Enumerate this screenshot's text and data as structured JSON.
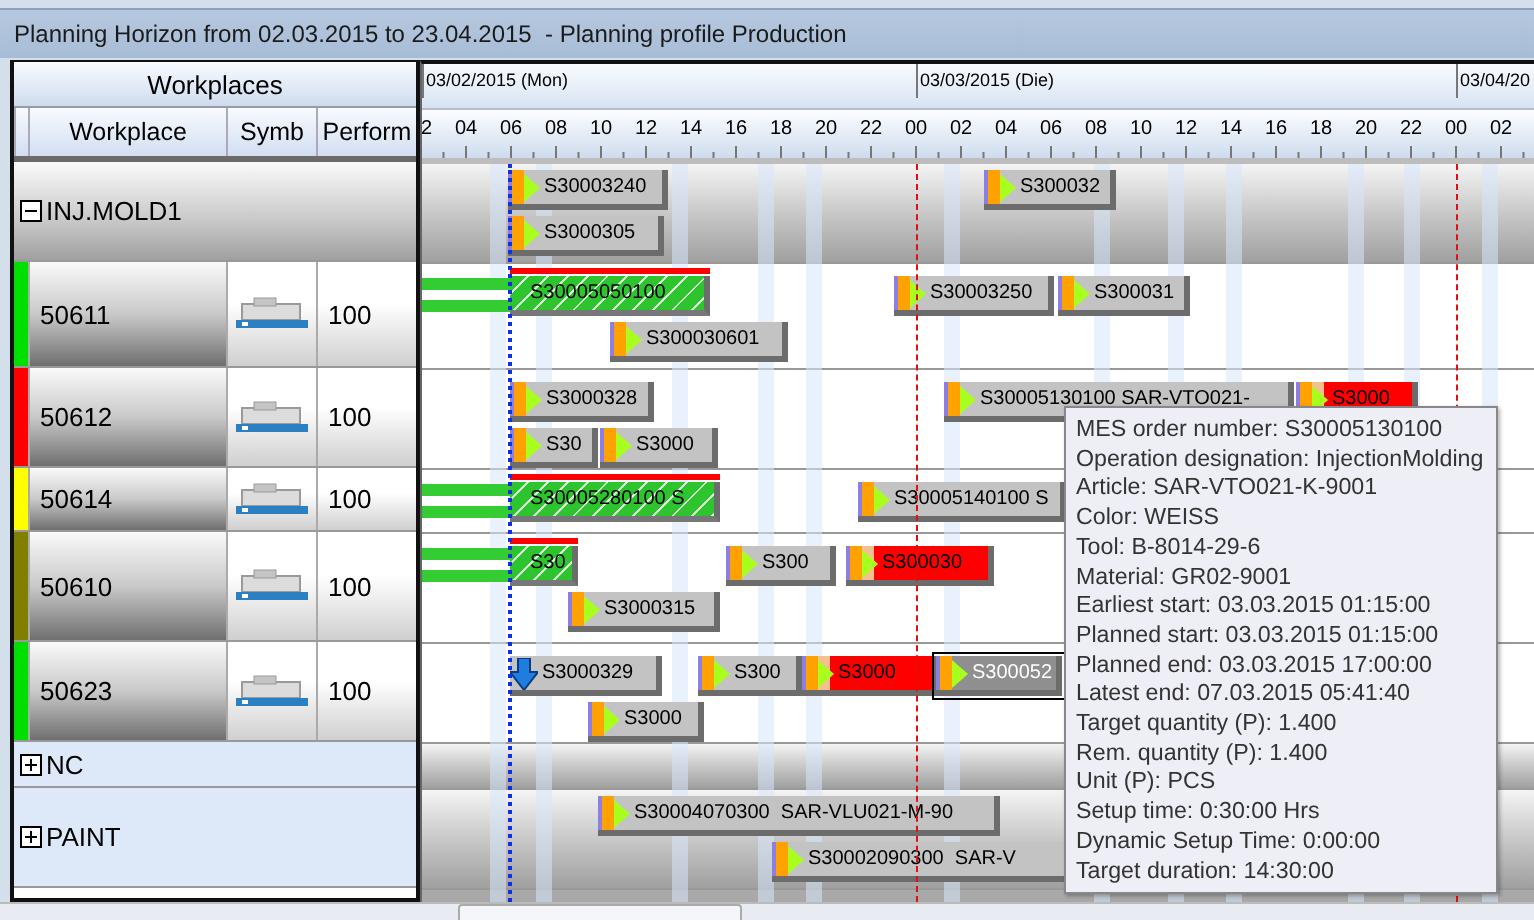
{
  "window": {
    "title": "Planning Horizon from 02.03.2015 to 23.04.2015  - Planning profile Production"
  },
  "left_header": {
    "title": "Workplaces",
    "columns": [
      "Workplace",
      "Symb",
      "Perform"
    ]
  },
  "timeline": {
    "days": [
      "03/02/2015 (Mon)",
      "03/03/2015 (Die)",
      "03/04/20"
    ],
    "hours": [
      "2",
      "04",
      "06",
      "08",
      "10",
      "12",
      "14",
      "16",
      "18",
      "20",
      "22",
      "00",
      "02",
      "04",
      "06",
      "08",
      "10",
      "12",
      "14",
      "16",
      "18",
      "20",
      "22",
      "00",
      "02"
    ]
  },
  "rows": [
    {
      "kind": "group",
      "label": "INJ.MOLD1",
      "expanded": true,
      "bars": [
        {
          "label": "S30003240",
          "kind": "normal",
          "selected": false
        },
        {
          "label": "S3000305",
          "kind": "normal",
          "selected": false
        },
        {
          "label": "S300032",
          "kind": "normal",
          "selected": false
        }
      ]
    },
    {
      "kind": "workplace",
      "label": "50611",
      "color": "#00e000",
      "perform": "100",
      "bars": [
        {
          "label": "S30005050100",
          "kind": "progress",
          "selected": false
        },
        {
          "label": "S30003250",
          "kind": "normal",
          "selected": false
        },
        {
          "label": "S300031",
          "kind": "normal",
          "selected": false
        },
        {
          "label": "S300030601",
          "kind": "normal",
          "selected": false
        }
      ]
    },
    {
      "kind": "workplace",
      "label": "50612",
      "color": "#ff0000",
      "perform": "100",
      "bars": [
        {
          "label": "S3000328",
          "kind": "normal",
          "selected": false
        },
        {
          "label": "S30005130100 SAR-VTO021-",
          "kind": "normal",
          "selected": false
        },
        {
          "label": "S3000",
          "kind": "late",
          "selected": false
        },
        {
          "label": "S30",
          "kind": "normal",
          "selected": false
        },
        {
          "label": "S3000",
          "kind": "normal",
          "selected": false
        }
      ]
    },
    {
      "kind": "workplace",
      "label": "50614",
      "color": "#ffff00",
      "perform": "100",
      "bars": [
        {
          "label": "S30005280100 S",
          "kind": "progress",
          "selected": false
        },
        {
          "label": "S30005140100 S",
          "kind": "normal",
          "selected": false
        }
      ]
    },
    {
      "kind": "workplace",
      "label": "50610",
      "color": "#808000",
      "perform": "100",
      "bars": [
        {
          "label": "S30",
          "kind": "progress",
          "selected": false
        },
        {
          "label": "S300",
          "kind": "normal",
          "selected": false
        },
        {
          "label": "S300030",
          "kind": "late",
          "selected": false
        },
        {
          "label": "S3000315",
          "kind": "normal",
          "selected": false
        }
      ]
    },
    {
      "kind": "workplace",
      "label": "50623",
      "color": "#00e000",
      "perform": "100",
      "bars": [
        {
          "label": "S3000329",
          "kind": "arrow",
          "selected": false
        },
        {
          "label": "S300",
          "kind": "normal",
          "selected": false
        },
        {
          "label": "S3000",
          "kind": "late",
          "selected": false
        },
        {
          "label": "S300052",
          "kind": "normal",
          "selected": true
        },
        {
          "label": "S3000",
          "kind": "normal",
          "selected": false
        }
      ]
    },
    {
      "kind": "group",
      "label": "NC",
      "expanded": false,
      "bars": []
    },
    {
      "kind": "group",
      "label": "PAINT",
      "expanded": false,
      "bars": [
        {
          "label": "S30004070300  SAR-VLU021-M-90",
          "kind": "normal",
          "selected": false
        },
        {
          "label": "S30002090300  SAR-V",
          "kind": "normal",
          "selected": false
        }
      ]
    }
  ],
  "tooltip": {
    "lines": [
      "MES order number: S30005130100",
      "Operation designation: InjectionMolding",
      "Article: SAR-VTO021-K-9001",
      "Color: WEISS",
      "Tool: B-8014-29-6",
      "Material: GR02-9001",
      "Earliest start: 03.03.2015 01:15:00",
      "Planned start: 03.03.2015 01:15:00",
      "Planned end: 03.03.2015 17:00:00",
      "Latest end: 07.03.2015 05:41:40",
      "Target quantity (P): 1.400",
      "Rem. quantity (P): 1.400",
      "Unit (P): PCS",
      "Setup time: 0:30:00 Hrs",
      "Dynamic Setup Time: 0:00:00",
      "Target duration: 14:30:00"
    ]
  }
}
